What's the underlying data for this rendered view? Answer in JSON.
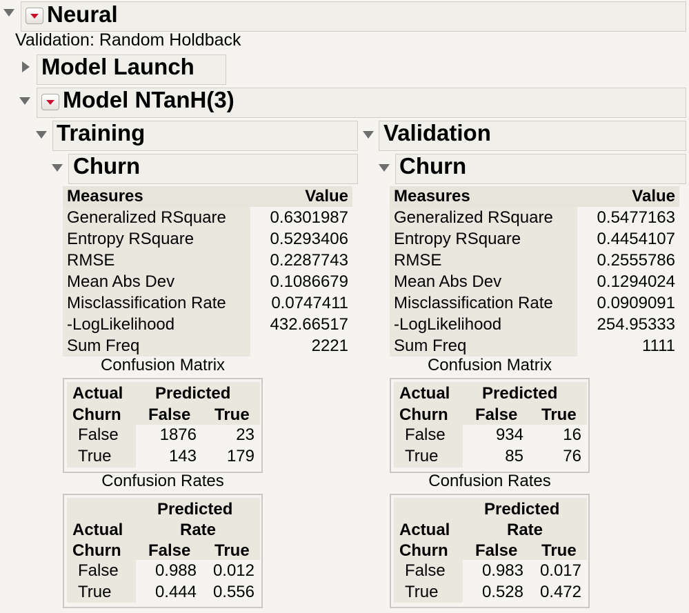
{
  "neural": {
    "title": "Neural",
    "validation_text": "Validation: Random Holdback"
  },
  "model_launch": {
    "title": "Model Launch"
  },
  "model": {
    "title": "Model NTanH(3)"
  },
  "training": {
    "title": "Training",
    "target": "Churn",
    "measures_header": "Measures",
    "value_header": "Value",
    "measures": [
      {
        "label": "Generalized RSquare",
        "value": "0.6301987"
      },
      {
        "label": "Entropy RSquare",
        "value": "0.5293406"
      },
      {
        "label": "RMSE",
        "value": "0.2287743"
      },
      {
        "label": "Mean Abs Dev",
        "value": "0.1086679"
      },
      {
        "label": "Misclassification Rate",
        "value": "0.0747411"
      },
      {
        "label": "-LogLikelihood",
        "value": "432.66517"
      },
      {
        "label": "Sum Freq",
        "value": "2221"
      }
    ],
    "confusion_matrix": {
      "caption": "Confusion Matrix",
      "actual": "Actual",
      "predicted": "Predicted",
      "row_header": "Churn",
      "col_false": "False",
      "col_true": "True",
      "rows": [
        {
          "label": "False",
          "false": "1876",
          "true": "23"
        },
        {
          "label": "True",
          "false": "143",
          "true": "179"
        }
      ]
    },
    "confusion_rates": {
      "caption": "Confusion Rates",
      "actual": "Actual",
      "predicted": "Predicted",
      "rate": "Rate",
      "row_header": "Churn",
      "col_false": "False",
      "col_true": "True",
      "rows": [
        {
          "label": "False",
          "false": "0.988",
          "true": "0.012"
        },
        {
          "label": "True",
          "false": "0.444",
          "true": "0.556"
        }
      ]
    }
  },
  "validation": {
    "title": "Validation",
    "target": "Churn",
    "measures_header": "Measures",
    "value_header": "Value",
    "measures": [
      {
        "label": "Generalized RSquare",
        "value": "0.5477163"
      },
      {
        "label": "Entropy RSquare",
        "value": "0.4454107"
      },
      {
        "label": "RMSE",
        "value": "0.2555786"
      },
      {
        "label": "Mean Abs Dev",
        "value": "0.1294024"
      },
      {
        "label": "Misclassification Rate",
        "value": "0.0909091"
      },
      {
        "label": "-LogLikelihood",
        "value": "254.95333"
      },
      {
        "label": "Sum Freq",
        "value": "1111"
      }
    ],
    "confusion_matrix": {
      "caption": "Confusion Matrix",
      "actual": "Actual",
      "predicted": "Predicted",
      "row_header": "Churn",
      "col_false": "False",
      "col_true": "True",
      "rows": [
        {
          "label": "False",
          "false": "934",
          "true": "16"
        },
        {
          "label": "True",
          "false": "85",
          "true": "76"
        }
      ]
    },
    "confusion_rates": {
      "caption": "Confusion Rates",
      "actual": "Actual",
      "predicted": "Predicted",
      "rate": "Rate",
      "row_header": "Churn",
      "col_false": "False",
      "col_true": "True",
      "rows": [
        {
          "label": "False",
          "false": "0.983",
          "true": "0.017"
        },
        {
          "label": "True",
          "false": "0.528",
          "true": "0.472"
        }
      ]
    }
  }
}
